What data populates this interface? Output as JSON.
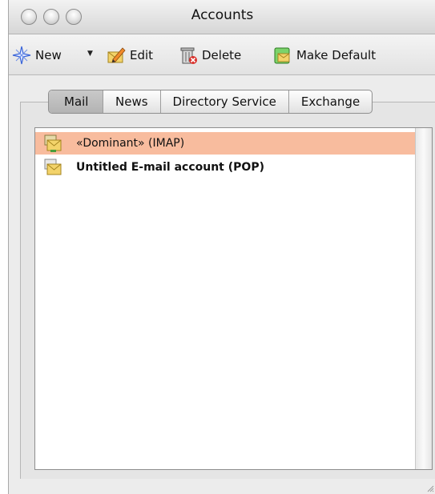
{
  "window": {
    "title": "Accounts"
  },
  "toolbar": {
    "new_label": "New",
    "edit_label": "Edit",
    "delete_label": "Delete",
    "make_default_label": "Make Default"
  },
  "tabs": [
    {
      "label": "Mail",
      "active": true
    },
    {
      "label": "News",
      "active": false
    },
    {
      "label": "Directory Service",
      "active": false
    },
    {
      "label": "Exchange",
      "active": false
    }
  ],
  "accounts": [
    {
      "label": "«Dominant» (IMAP)",
      "selected": true,
      "bold": false,
      "icon": "imap-mailbox-icon"
    },
    {
      "label": "Untitled E-mail account (POP)",
      "selected": false,
      "bold": true,
      "icon": "pop-mailbox-icon"
    }
  ],
  "colors": {
    "selection": "#f8bc9e"
  }
}
